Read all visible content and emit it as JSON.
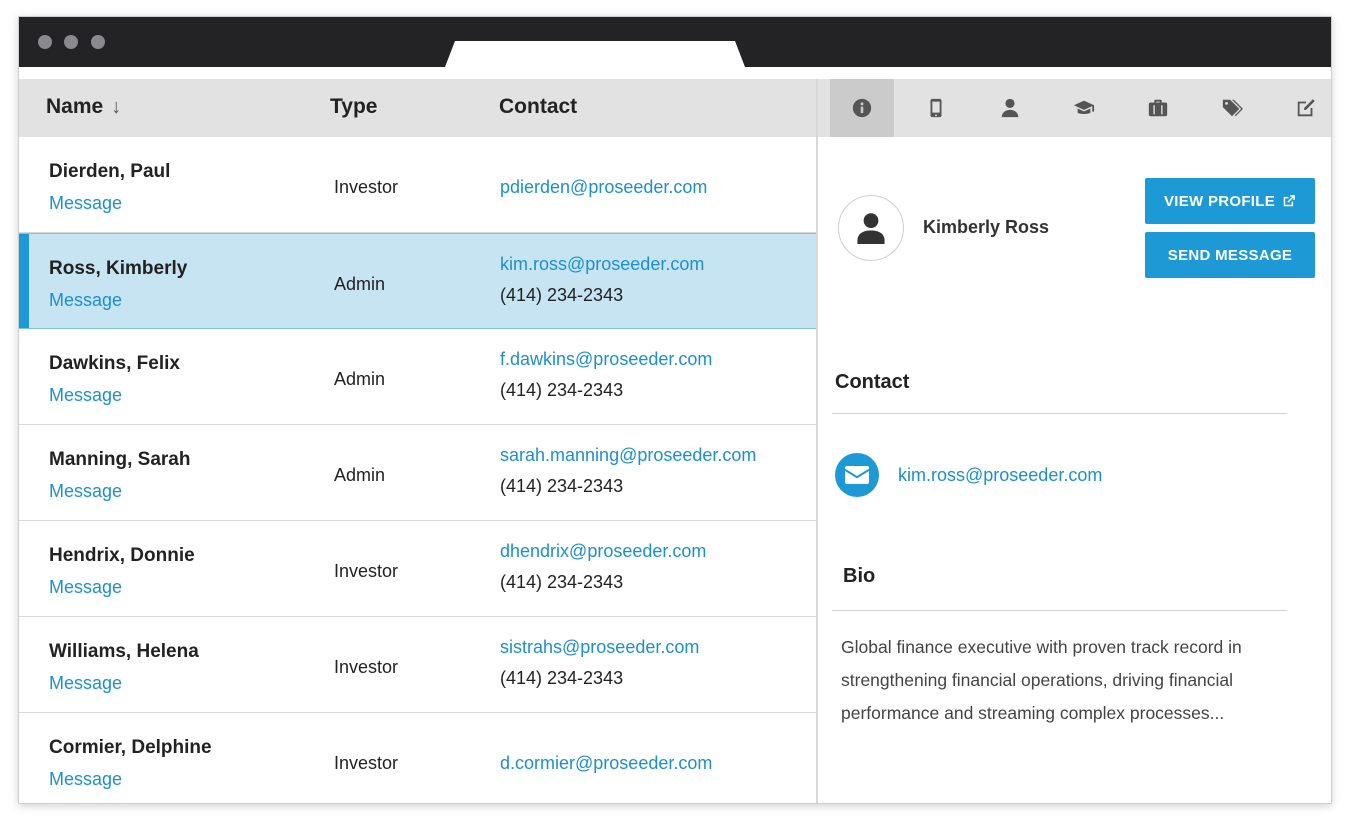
{
  "list": {
    "headers": {
      "name": "Name",
      "sort_arrow": "↓",
      "type": "Type",
      "contact": "Contact"
    },
    "rows": [
      {
        "name": "Dierden, Paul",
        "message": "Message",
        "type": "Investor",
        "email": "pdierden@proseeder.com",
        "phone": ""
      },
      {
        "name": "Ross, Kimberly",
        "message": "Message",
        "type": "Admin",
        "email": "kim.ross@proseeder.com",
        "phone": "(414) 234-2343"
      },
      {
        "name": "Dawkins, Felix",
        "message": "Message",
        "type": "Admin",
        "email": "f.dawkins@proseeder.com",
        "phone": "(414) 234-2343"
      },
      {
        "name": "Manning, Sarah",
        "message": "Message",
        "type": "Admin",
        "email": "sarah.manning@proseeder.com",
        "phone": "(414) 234-2343"
      },
      {
        "name": "Hendrix, Donnie",
        "message": "Message",
        "type": "Investor",
        "email": "dhendrix@proseeder.com",
        "phone": "(414) 234-2343"
      },
      {
        "name": "Williams, Helena",
        "message": "Message",
        "type": "Investor",
        "email": "sistrahs@proseeder.com",
        "phone": "(414) 234-2343"
      },
      {
        "name": "Cormier, Delphine",
        "message": "Message",
        "type": "Investor",
        "email": "d.cormier@proseeder.com",
        "phone": ""
      }
    ],
    "selected_index": 1
  },
  "panel": {
    "tabs": [
      "info-icon",
      "mobile-icon",
      "user-icon",
      "graduation-cap-icon",
      "briefcase-icon",
      "tags-icon",
      "edit-icon"
    ],
    "active_tab": 0,
    "profile_name": "Kimberly Ross",
    "view_profile_label": "VIEW PROFILE",
    "send_message_label": "SEND MESSAGE",
    "contact_title": "Contact",
    "contact_email": "kim.ross@proseeder.com",
    "bio_title": "Bio",
    "bio_text": "Global finance executive with proven track record in strengthening financial operations, driving financial performance and streaming complex processes..."
  },
  "colors": {
    "accent": "#1d9ad6",
    "link": "#1d8fcf",
    "selected_row": "#c6e4f2",
    "header_bg": "#e2e2e2",
    "titlebar": "#232326"
  }
}
